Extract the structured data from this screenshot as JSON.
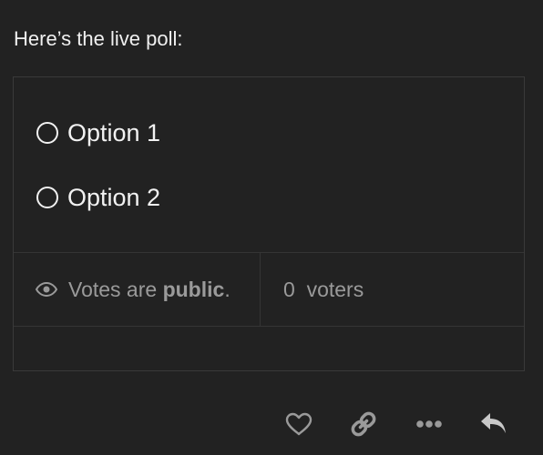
{
  "post": {
    "intro_text": "Here’s the live poll:"
  },
  "poll": {
    "options": [
      {
        "label": "Option 1"
      },
      {
        "label": "Option 2"
      }
    ],
    "visibility": {
      "prefix": "Votes are ",
      "emphasis": "public",
      "suffix": "."
    },
    "voters": {
      "count": "0",
      "label": "voters"
    }
  },
  "actions": {
    "icons": [
      "heart-icon",
      "link-icon",
      "more-icon",
      "reply-icon"
    ]
  },
  "colors": {
    "background": "#222222",
    "text": "#f2f2f2",
    "muted": "#9a9a9a",
    "border": "#3a3a3a"
  }
}
